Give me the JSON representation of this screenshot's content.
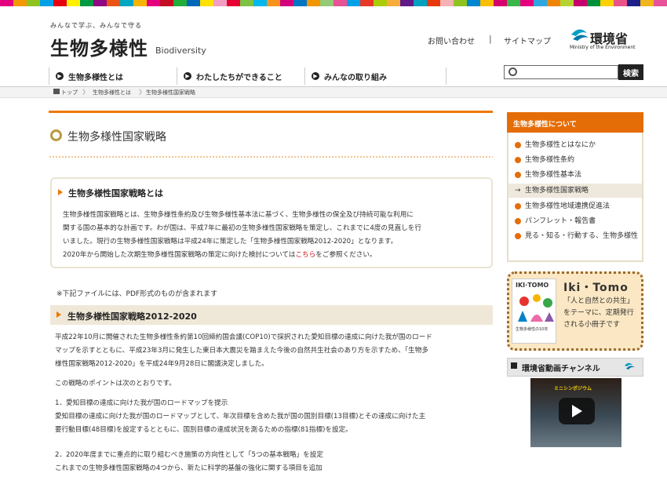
{
  "colors": {
    "accent": "#ee7800",
    "sidebar_header": "#e56d07",
    "link": "#c8161d",
    "stripe": [
      "#e3007f",
      "#f39800",
      "#8fc31f",
      "#00a0e9",
      "#e60012",
      "#fff100",
      "#009944",
      "#920783",
      "#ea5413",
      "#00a7c2",
      "#f8b500",
      "#e4007f",
      "#c30d23",
      "#22ac38",
      "#0068b7",
      "#ffe100",
      "#f19ec2",
      "#e60033",
      "#7dc242",
      "#00b7ee",
      "#f7931e",
      "#d2007c",
      "#0075c2",
      "#f29600",
      "#93ca76",
      "#e95295",
      "#00a1e9",
      "#e83828",
      "#abcd03",
      "#f6ad3c",
      "#601986",
      "#00a0c1",
      "#e7380d",
      "#f5b2b2",
      "#8fc320",
      "#0086d1",
      "#fabe00",
      "#d7006d",
      "#39b54a",
      "#e6007e",
      "#2ea7e0",
      "#f08300",
      "#b5d334",
      "#c7006d",
      "#00913a",
      "#fdd000",
      "#e95388",
      "#1d2088",
      "#f0b61a",
      "#e85298"
    ]
  },
  "header": {
    "tagline": "みんなで学ぶ、みんなで守る",
    "site_title": "生物多様性",
    "site_subtitle": "Biodiversity",
    "contact_link": "お問い合わせ",
    "separator": "|",
    "sitemap_link": "サイトマップ",
    "ministry_name": "環境省",
    "ministry_en": "Ministry of the Environment"
  },
  "nav": {
    "items": [
      {
        "label": "生物多様性とは"
      },
      {
        "label": "わたしたちができること"
      },
      {
        "label": "みんなの取り組み"
      }
    ]
  },
  "search": {
    "placeholder": "",
    "button_label": "検索"
  },
  "breadcrumb": [
    "トップ",
    "生物多様性とは",
    "生物多様性国家戦略"
  ],
  "page": {
    "title": "生物多様性国家戦略"
  },
  "intro": {
    "heading": "生物多様性国家戦略とは",
    "lines": [
      "生物多様性国家戦略とは、生物多様性条約及び生物多様性基本法に基づく、生物多様性の保全及び持続可能な利用に",
      "関する国の基本的な計画です。わが国は、平成7年に最初の生物多様性国家戦略を策定し、これまでに4度の見直しを行",
      "いました。現行の生物多様性国家戦略は平成24年に策定した「生物多様性国家戦略2012-2020」となります。"
    ],
    "last_line_pre": "2020年から開始した次期生物多様性国家戦略の策定に向けた検討については",
    "last_line_link": "こちら",
    "last_line_post": "をご参照ください。"
  },
  "pdf_note": "※下記ファイルには、PDF形式のものが含まれます",
  "section": {
    "heading": "生物多様性国家戦略2012-2020",
    "paragraph": [
      "平成22年10月に開催された生物多様性条約第10回締約国会議(COP10)で採択された愛知目標の達成に向けた我が国のロード",
      "マップを示すとともに、平成23年3月に発生した東日本大震災を踏まえた今後の自然共生社会のあり方を示すため、「生物多",
      "様性国家戦略2012-2020」を平成24年9月28日に閣議決定しました。"
    ],
    "points_intro": "この戦略のポイントは次のとおりです。",
    "point1_title": "1．愛知目標の達成に向けた我が国のロードマップを提示",
    "point1_text": [
      "愛知目標の達成に向けた我が国のロードマップとして、年次目標を含めた我が国の国別目標(13目標)とその達成に向けた主",
      "要行動目標(48目標)を設定するとともに、国別目標の達成状況を測るための指標(81指標)を設定。"
    ],
    "point2_title": "2．2020年度までに重点的に取り組むべき施策の方向性として「5つの基本戦略」を設定",
    "point2_text": "これまでの生物多様性国家戦略の4つから、新たに科学的基盤の強化に関する項目を追加"
  },
  "sidebar": {
    "heading": "生物多様性について",
    "items": [
      {
        "label": "生物多様性とはなにか"
      },
      {
        "label": "生物多様性条約"
      },
      {
        "label": "生物多様性基本法"
      },
      {
        "label": "生物多様性国家戦略"
      },
      {
        "label": "生物多様性地域連携促進法"
      },
      {
        "label": "パンフレット・報告書"
      },
      {
        "label": "見る・知る・行動する、生物多様性"
      }
    ]
  },
  "ikitomo": {
    "logo": "Iki・Tomo",
    "description": "「人と自然との共生」をテーマに、定期発行される小冊子です",
    "cover_title": "生物多様性の10年"
  },
  "video": {
    "heading": "環境省動画チャンネル",
    "caption": "ミニシンポジウム"
  }
}
